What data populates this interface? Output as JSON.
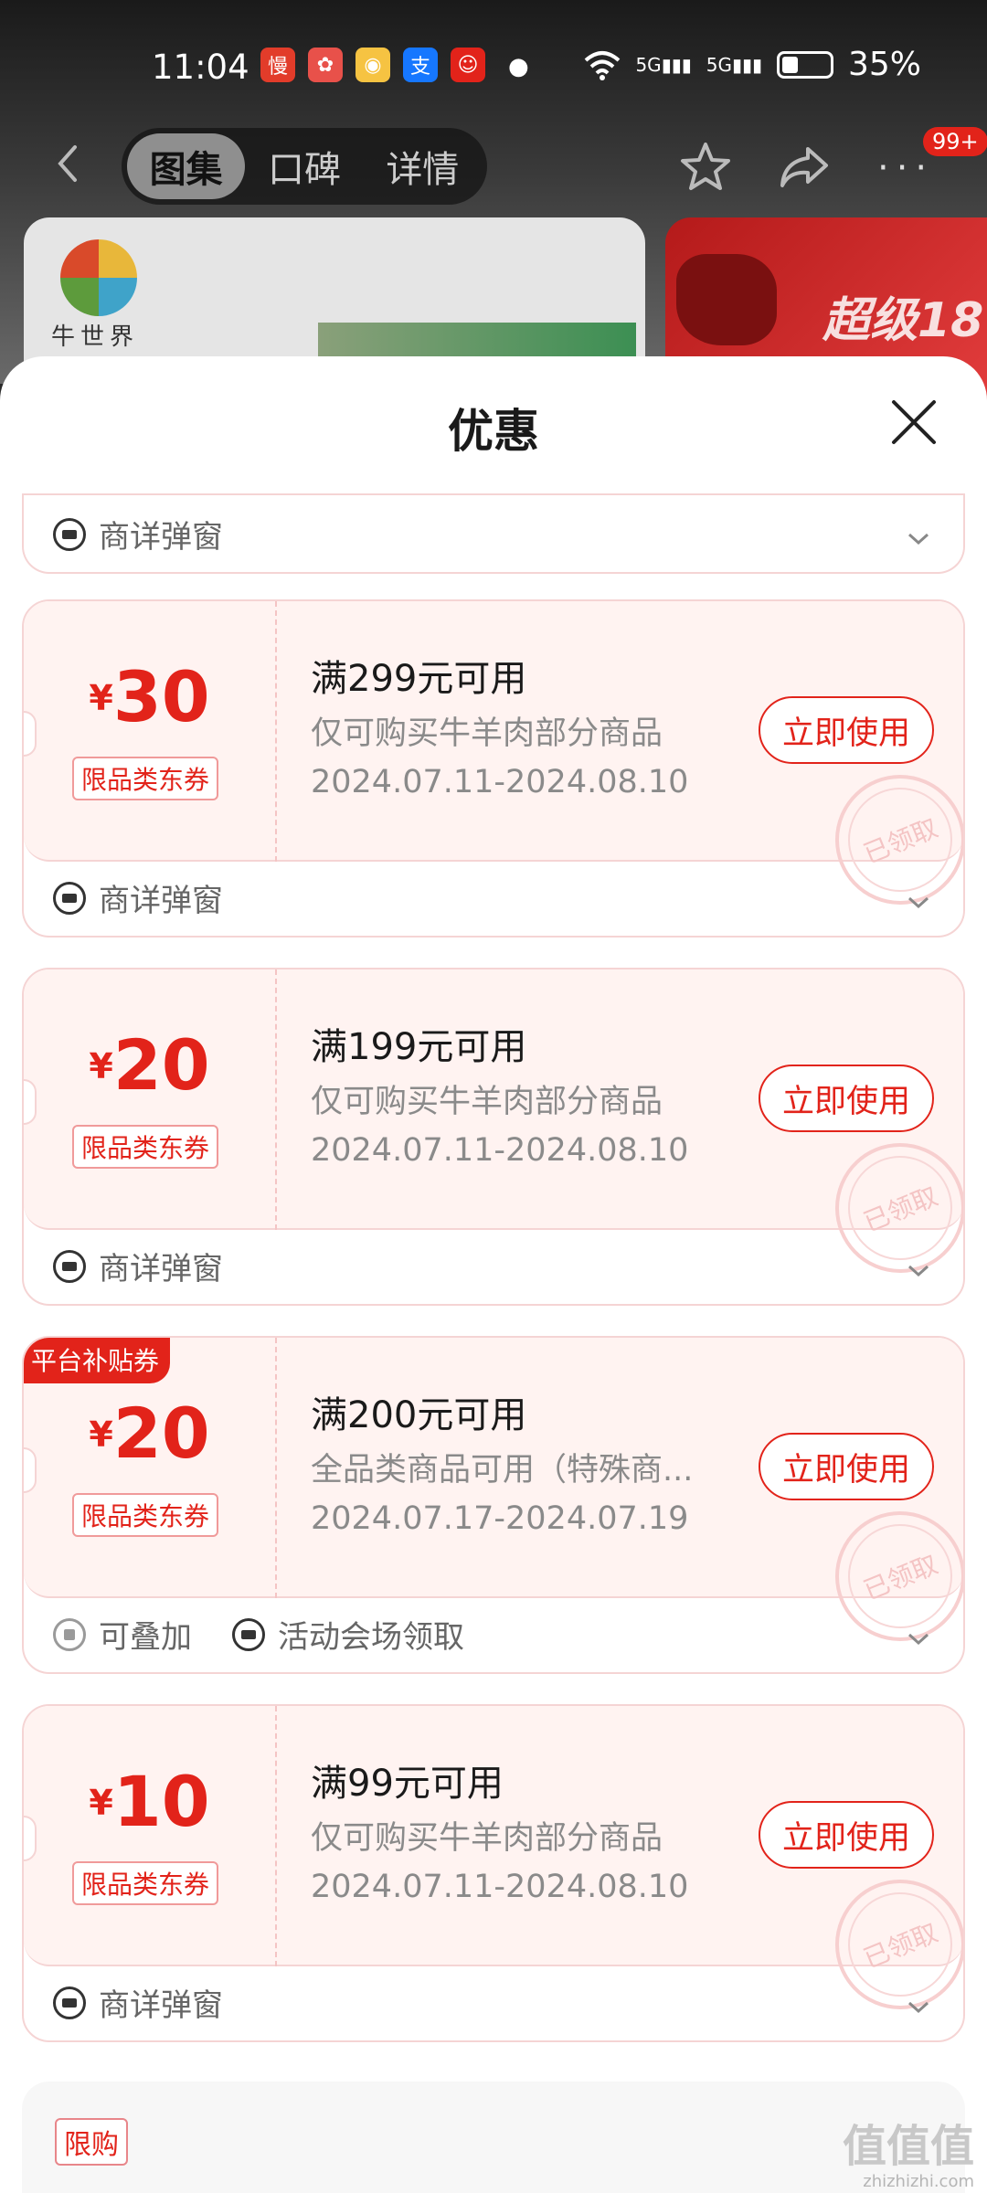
{
  "status_bar": {
    "time": "11:04",
    "signal_1": "5G",
    "signal_2": "5G",
    "battery": "35%"
  },
  "nav": {
    "tabs": [
      "图集",
      "口碑",
      "详情"
    ],
    "active_tab": 0,
    "badge": "99+"
  },
  "product": {
    "brand_logo_text": "牛世界",
    "promo_text": "超级18"
  },
  "sheet": {
    "title": "优惠"
  },
  "first_row": {
    "label": "商详弹窗"
  },
  "coupons": [
    {
      "yen": "¥",
      "amount": "30",
      "tag": "限品类东券",
      "condition": "满299元可用",
      "scope": "仅可购买牛羊肉部分商品",
      "date": "2024.07.11-2024.08.10",
      "button": "立即使用",
      "stamp": "已领取",
      "footer": [
        "商详弹窗"
      ]
    },
    {
      "yen": "¥",
      "amount": "20",
      "tag": "限品类东券",
      "condition": "满199元可用",
      "scope": "仅可购买牛羊肉部分商品",
      "date": "2024.07.11-2024.08.10",
      "button": "立即使用",
      "stamp": "已领取",
      "footer": [
        "商详弹窗"
      ]
    },
    {
      "yen": "¥",
      "amount": "20",
      "tag": "限品类东券",
      "platform_tag": "平台补贴券",
      "condition": "满200元可用",
      "scope": "全品类商品可用（特殊商...",
      "date": "2024.07.17-2024.07.19",
      "button": "立即使用",
      "stamp": "已领取",
      "footer": [
        "可叠加",
        "活动会场领取"
      ]
    },
    {
      "yen": "¥",
      "amount": "10",
      "tag": "限品类东券",
      "condition": "满99元可用",
      "scope": "仅可购买牛羊肉部分商品",
      "date": "2024.07.11-2024.08.10",
      "button": "立即使用",
      "stamp": "已领取",
      "footer": [
        "商详弹窗"
      ]
    }
  ],
  "limit": {
    "tag": "限购"
  },
  "watermark": {
    "text": "值值值",
    "sub": "zhizhizhi.com"
  },
  "colors": {
    "accent": "#e2231a",
    "coupon_bg": "#fff3f1"
  },
  "icons": [
    "back-icon",
    "star-icon",
    "share-icon",
    "more-icon",
    "close-icon",
    "coupon-ticket-icon",
    "stack-icon",
    "chevron-down-icon"
  ]
}
